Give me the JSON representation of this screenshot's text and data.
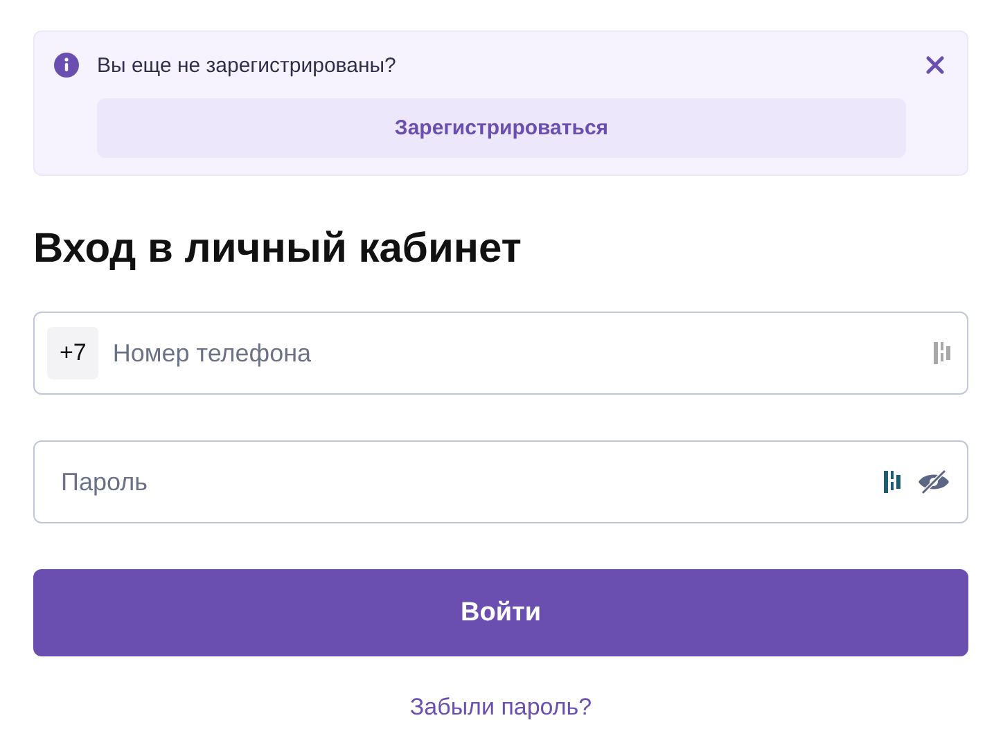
{
  "notice": {
    "message": "Вы еще не зарегистрированы?",
    "action": "Зарегистрироваться"
  },
  "title": "Вход в личный кабинет",
  "fields": [
    {
      "kind": "phone",
      "prefix": "+7",
      "placeholder": "Номер телефона",
      "manager_active": false
    },
    {
      "kind": "password",
      "placeholder": "Пароль",
      "manager_active": true
    }
  ],
  "submit": "Войти",
  "forgot_link": "Забыли пароль?"
}
